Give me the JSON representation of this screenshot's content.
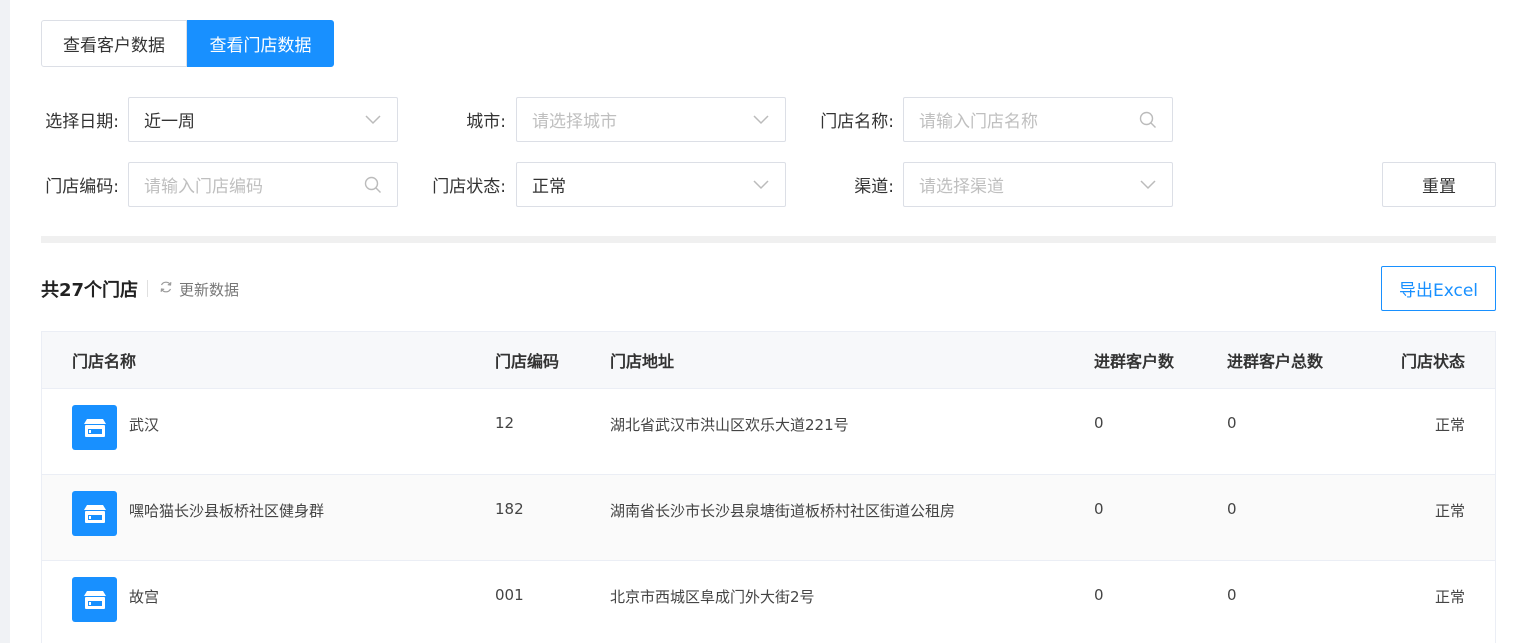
{
  "tabs": [
    {
      "label": "查看客户数据",
      "active": false
    },
    {
      "label": "查看门店数据",
      "active": true
    }
  ],
  "filters": {
    "date": {
      "label": "选择日期:",
      "value": "近一周"
    },
    "city": {
      "label": "城市:",
      "placeholder": "请选择城市"
    },
    "store_name": {
      "label": "门店名称:",
      "placeholder": "请输入门店名称"
    },
    "store_code": {
      "label": "门店编码:",
      "placeholder": "请输入门店编码"
    },
    "store_status": {
      "label": "门店状态:",
      "value": "正常"
    },
    "channel": {
      "label": "渠道:",
      "placeholder": "请选择渠道"
    },
    "reset_label": "重置"
  },
  "summary": {
    "count_text": "共27个门店",
    "refresh_label": "更新数据",
    "export_label": "导出Excel"
  },
  "table": {
    "headers": [
      "门店名称",
      "门店编码",
      "门店地址",
      "进群客户数",
      "进群客户总数",
      "门店状态"
    ],
    "rows": [
      {
        "name": "武汉",
        "code": "12",
        "address": "湖北省武汉市洪山区欢乐大道221号",
        "joined": "0",
        "joined_total": "0",
        "status": "正常"
      },
      {
        "name": "嘿哈猫长沙县板桥社区健身群",
        "code": "182",
        "address": "湖南省长沙市长沙县泉塘街道板桥村社区街道公租房",
        "joined": "0",
        "joined_total": "0",
        "status": "正常"
      },
      {
        "name": "故宫",
        "code": "001",
        "address": "北京市西城区阜成门外大街2号",
        "joined": "0",
        "joined_total": "0",
        "status": "正常"
      }
    ]
  },
  "colors": {
    "accent": "#1890ff",
    "border": "#dcdfe6",
    "placeholder": "#bfbfbf"
  }
}
